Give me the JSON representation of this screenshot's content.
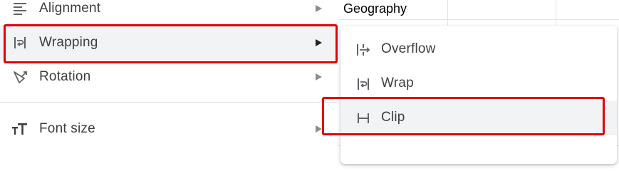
{
  "sheet": {
    "cell_value": "Geography"
  },
  "context_menu": {
    "items": [
      {
        "label": "Alignment",
        "icon": "align-left-icon",
        "has_submenu": true
      },
      {
        "label": "Wrapping",
        "icon": "text-wrap-icon",
        "has_submenu": true,
        "active": true
      },
      {
        "label": "Rotation",
        "icon": "text-rotation-icon",
        "has_submenu": true
      },
      {
        "label": "Font size",
        "icon": "font-size-icon",
        "has_submenu": true
      }
    ]
  },
  "wrapping_submenu": {
    "items": [
      {
        "label": "Overflow",
        "icon": "wrap-overflow-icon"
      },
      {
        "label": "Wrap",
        "icon": "wrap-wrap-icon"
      },
      {
        "label": "Clip",
        "icon": "wrap-clip-icon",
        "hovered": true
      }
    ]
  },
  "colors": {
    "highlight": "#e0000b",
    "active_bg": "#f1f3f4",
    "text": "#3c4043",
    "icon": "#5f6368"
  }
}
